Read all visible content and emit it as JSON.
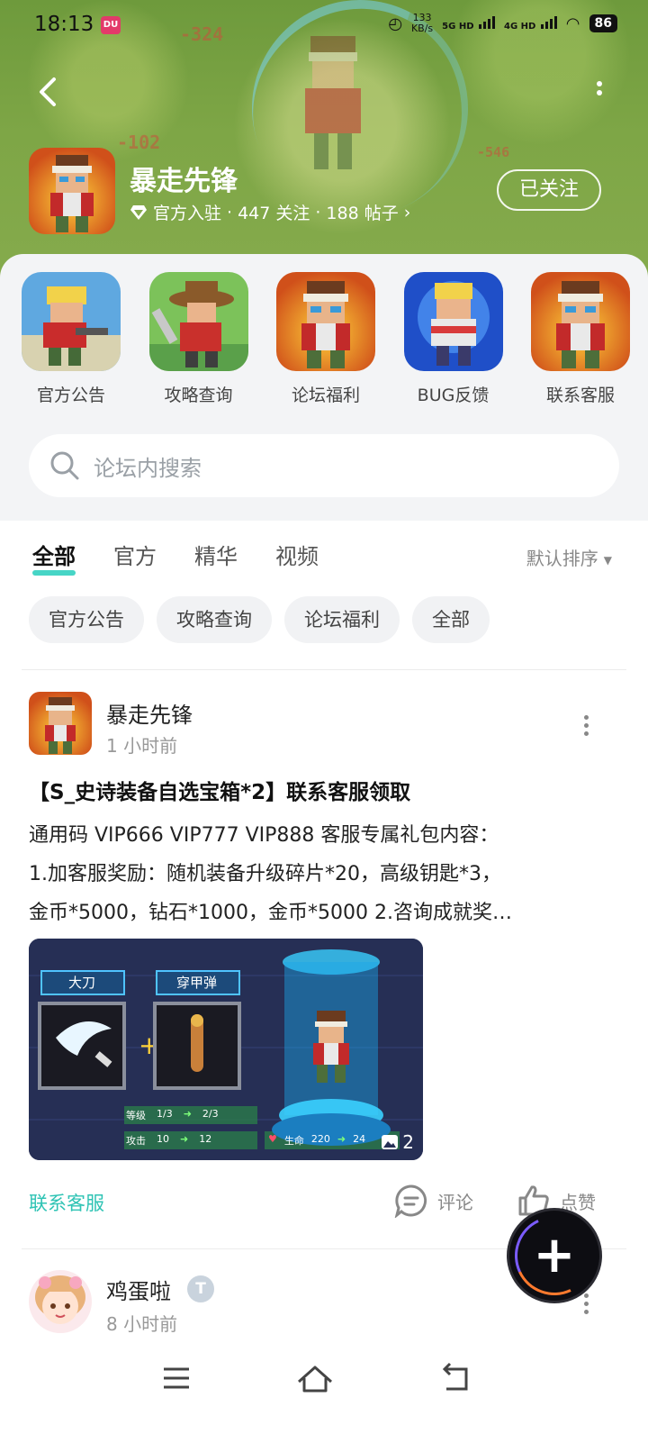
{
  "status_bar": {
    "time": "18:13",
    "app_badge": "DU",
    "net_speed_top": "133",
    "net_speed_bottom": "KB/s",
    "sig1": "5G HD",
    "sig2": "4G HD",
    "battery": "86"
  },
  "header": {
    "game_name": "暴走先锋",
    "verified_label": "官方入驻",
    "followers": "447 关注",
    "posts": "188 帖子",
    "separator": "·",
    "follow_button": "已关注",
    "bg_damage": [
      "-324",
      "-102",
      "-546"
    ]
  },
  "quick_tiles": [
    {
      "label": "官方公告",
      "icon": "blonde-soldier-art"
    },
    {
      "label": "攻略查询",
      "icon": "cowboy-hero-art"
    },
    {
      "label": "论坛福利",
      "icon": "headband-soldier-art"
    },
    {
      "label": "BUG反馈",
      "icon": "blue-soldier-art"
    },
    {
      "label": "联系客服",
      "icon": "headband-soldier-art"
    }
  ],
  "search": {
    "placeholder": "论坛内搜索"
  },
  "tabs": [
    {
      "label": "全部",
      "active": true
    },
    {
      "label": "官方",
      "active": false
    },
    {
      "label": "精华",
      "active": false
    },
    {
      "label": "视频",
      "active": false
    }
  ],
  "sort": {
    "label": "默认排序"
  },
  "filters": [
    "官方公告",
    "攻略查询",
    "论坛福利",
    "全部"
  ],
  "posts": [
    {
      "author": "暴走先锋",
      "time": "1 小时前",
      "title": "【S_史诗装备自选宝箱*2】联系客服领取",
      "body_lines": [
        "通用码 VIP666 VIP777 VIP888 客服专属礼包内容：",
        "1.加客服奖励：随机装备升级碎片*20，高级钥匙*3，",
        "金币*5000，钻石*1000，金币*5000 2.咨询成就奖…"
      ],
      "image": {
        "weapon_label": "大刀",
        "ammo_label": "穿甲弹",
        "level_label": "等级",
        "level_from": "1/3",
        "level_to": "2/3",
        "attack_label": "攻击",
        "attack_from": "10",
        "attack_to": "12",
        "hp_label": "生命",
        "hp_from": "220",
        "hp_to": "24",
        "image_count": "2"
      },
      "tag": "联系客服",
      "comment_label": "评论",
      "like_label": "点赞"
    },
    {
      "author": "鸡蛋啦",
      "time": "8 小时前",
      "badge": "T"
    }
  ],
  "fab": {
    "label": "+"
  },
  "colors": {
    "accent": "#2ec3b4",
    "tab_indicator": "#33d0c0",
    "header_green": "#7ea646"
  }
}
